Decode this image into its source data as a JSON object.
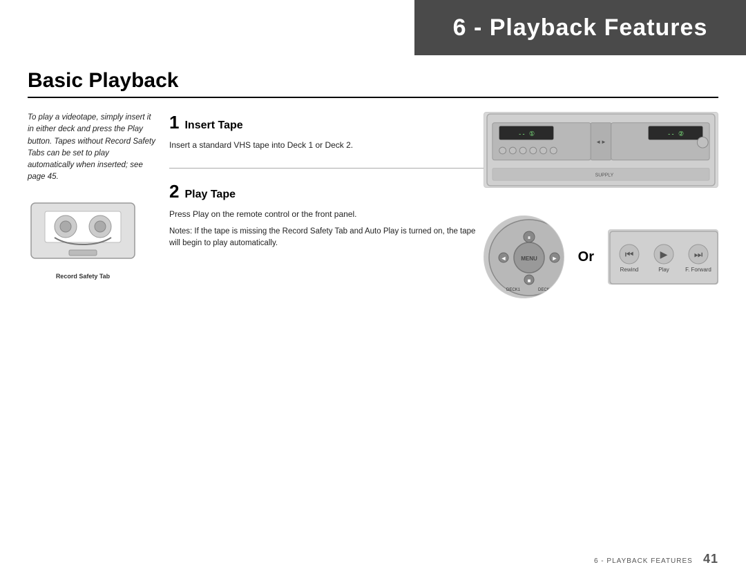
{
  "header": {
    "title": "6 - Playback Features",
    "background": "#4a4a4a",
    "text_color": "#ffffff"
  },
  "section": {
    "title": "Basic Playback"
  },
  "left_column": {
    "intro_text": "To play a videotape, simply insert it in either deck and press the Play button. Tapes without Record Safety Tabs can be set to play automatically when inserted; see page 45.",
    "tape_label": "Record Safety Tab"
  },
  "steps": [
    {
      "number": "1",
      "title": "Insert Tape",
      "description": "Insert a standard VHS tape into Deck 1 or Deck 2."
    },
    {
      "number": "2",
      "title": "Play Tape",
      "description": "Press Play on the remote control or the front panel.",
      "notes": "Notes: If the tape is missing the Record Safety Tab and Auto Play is turned on, the tape will begin to play automatically."
    }
  ],
  "or_text": "Or",
  "footer": {
    "text": "6 - PLAYBACK FEATURES",
    "page_number": "41"
  }
}
